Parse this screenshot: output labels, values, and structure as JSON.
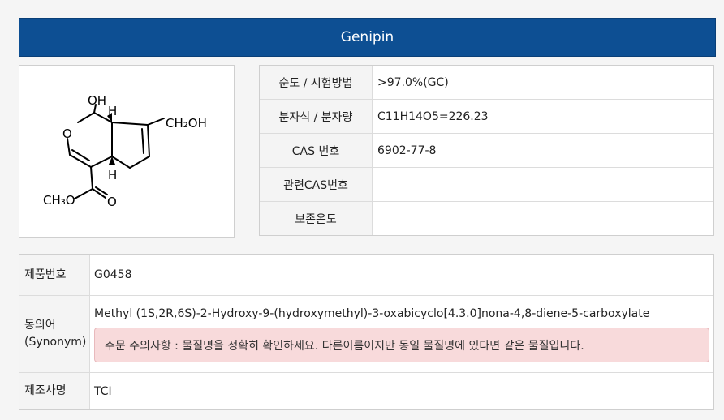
{
  "header": {
    "title": "Genipin"
  },
  "structure": {
    "labels": {
      "oh_top": "OH",
      "h_top": "H",
      "ring_o": "O",
      "ch2oh": "CH₂OH",
      "h_bottom": "H",
      "ch3o": "CH₃O",
      "carbonyl_o": "O"
    }
  },
  "properties": [
    {
      "label": "순도 / 시험방법",
      "value": ">97.0%(GC)"
    },
    {
      "label": "분자식 / 분자량",
      "value": "C11H14O5=226.23"
    },
    {
      "label": "CAS 번호",
      "value": "6902-77-8"
    },
    {
      "label": "관련CAS번호",
      "value": ""
    },
    {
      "label": "보존온도",
      "value": ""
    }
  ],
  "info": {
    "product_no": {
      "label": "제품번호",
      "value": "G0458"
    },
    "synonym": {
      "label_line1": "동의어",
      "label_line2": "(Synonym)",
      "value": "Methyl (1S,2R,6S)-2-Hydroxy-9-(hydroxymethyl)-3-oxabicyclo[4.3.0]nona-4,8-diene-5-carboxylate",
      "notice": "주문 주의사항 : 물질명을 정확히 확인하세요. 다른이름이지만 동일 물질명에 있다면 같은 물질입니다."
    },
    "manufacturer": {
      "label": "제조사명",
      "value": "TCI"
    }
  }
}
